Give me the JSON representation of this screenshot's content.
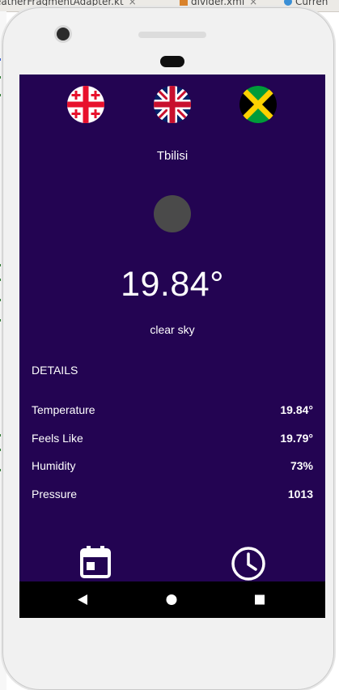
{
  "ide": {
    "tabs": [
      {
        "label": "eatherFragmentAdapter.kt",
        "icon": "kotlin-file-icon"
      },
      {
        "label": "divider.xml",
        "icon": "xml-file-icon"
      },
      {
        "label": "Curren",
        "icon": "kotlin-class-icon"
      }
    ]
  },
  "app": {
    "flags": [
      {
        "name": "georgia-flag-icon"
      },
      {
        "name": "united-kingdom-flag-icon"
      },
      {
        "name": "jamaica-flag-icon"
      }
    ],
    "city": "Tbilisi",
    "temperature": "19.84°",
    "description": "clear sky",
    "details_title": "DETAILS",
    "details": [
      {
        "label": "Temperature",
        "value": "19.84°"
      },
      {
        "label": "Feels Like",
        "value": "19.79°"
      },
      {
        "label": "Humidity",
        "value": "73%"
      },
      {
        "label": "Pressure",
        "value": "1013"
      }
    ],
    "bottom_icons": [
      "calendar-icon",
      "clock-icon"
    ]
  },
  "colors": {
    "screen_bg": "#230452",
    "text": "#ffffff",
    "navbar": "#000000"
  }
}
